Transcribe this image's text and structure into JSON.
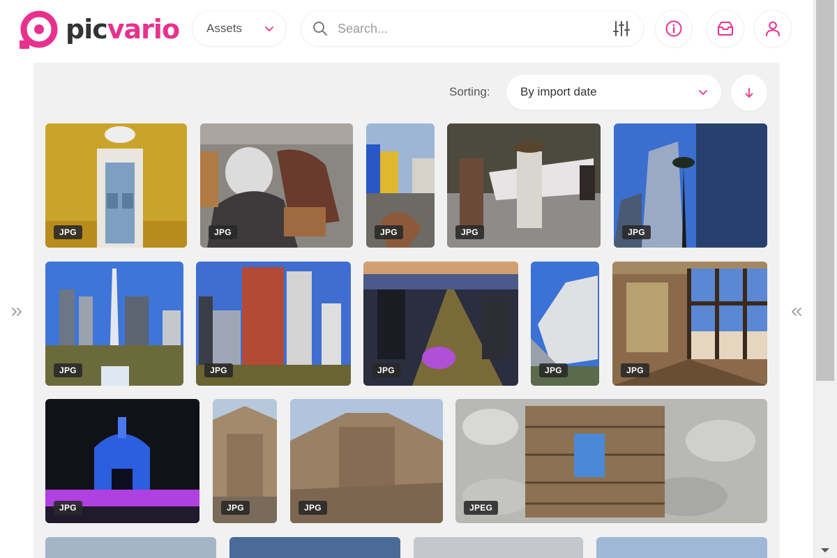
{
  "header": {
    "logo": {
      "text_a": "pic",
      "text_b": "vario"
    },
    "assets_dropdown": {
      "label": "Assets"
    },
    "search": {
      "placeholder": "Search..."
    }
  },
  "sorting": {
    "label": "Sorting:",
    "selected": "By import date"
  },
  "colors": {
    "accent": "#e8318f",
    "panel_bg": "#f1f1f1",
    "badge_bg": "#282828"
  },
  "icons": {
    "search": "search-icon",
    "filters": "filters-icon",
    "info": "info-icon",
    "inbox": "inbox-icon",
    "user": "user-icon",
    "sort_direction": "arrow-down-icon",
    "expand_left": "double-chevron-right-icon",
    "expand_right": "double-chevron-left-icon"
  },
  "assets": [
    {
      "format": "JPG"
    },
    {
      "format": "JPG"
    },
    {
      "format": "JPG"
    },
    {
      "format": "JPG"
    },
    {
      "format": "JPG"
    },
    {
      "format": "JPG"
    },
    {
      "format": "JPG"
    },
    {
      "format": "JPG"
    },
    {
      "format": "JPG"
    },
    {
      "format": "JPG"
    },
    {
      "format": "JPG"
    },
    {
      "format": "JPG"
    },
    {
      "format": "JPG"
    },
    {
      "format": "JPEG"
    },
    {
      "format": ""
    },
    {
      "format": ""
    },
    {
      "format": ""
    },
    {
      "format": ""
    }
  ]
}
